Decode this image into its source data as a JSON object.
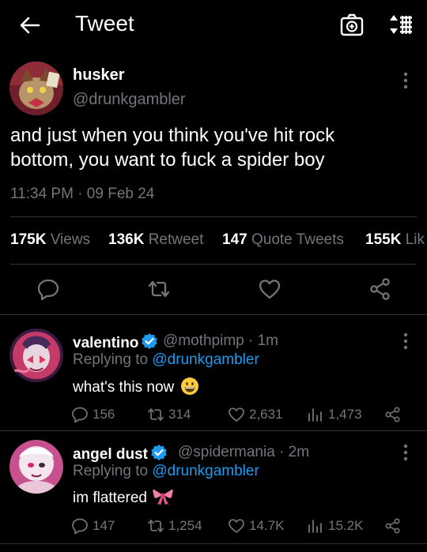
{
  "header": {
    "title": "Tweet"
  },
  "tweet": {
    "display_name": "husker",
    "handle": "@drunkgambler",
    "text_line1": "and just when you think you've hit rock",
    "text_line2": "bottom, you want to fuck a spider boy",
    "timestamp": "11:34 PM · 09 Feb 24",
    "stats": [
      {
        "num": "175K",
        "label": "Views"
      },
      {
        "num": "136K",
        "label": "Retweet"
      },
      {
        "num": "147",
        "label": "Quote Tweets"
      },
      {
        "num": "155K",
        "label": "Lik"
      }
    ]
  },
  "replies": [
    {
      "display_name": "valentino",
      "handle_time": "@mothpimp · 1m",
      "replying_prefix": "Replying to",
      "replying_to": "@drunkgambler",
      "text": "what's this now",
      "emoji": "grinning-face-emoji",
      "counts": {
        "reply": "156",
        "retweet": "314",
        "like": "2,631",
        "views": "1,473"
      }
    },
    {
      "display_name": "angel dust",
      "handle_time": "@spidermania · 2m",
      "replying_prefix": "Replying to",
      "replying_to": "@drunkgambler",
      "text": "im flattered",
      "emoji": "ribbon-emoji",
      "counts": {
        "reply": "147",
        "retweet": "1,254",
        "like": "14.7K",
        "views": "15.2K"
      }
    }
  ],
  "colors": {
    "background": "#000000",
    "text": "#e7e9ea",
    "muted": "#71767b",
    "link": "#1d9bf0",
    "divider": "#2f3336"
  }
}
